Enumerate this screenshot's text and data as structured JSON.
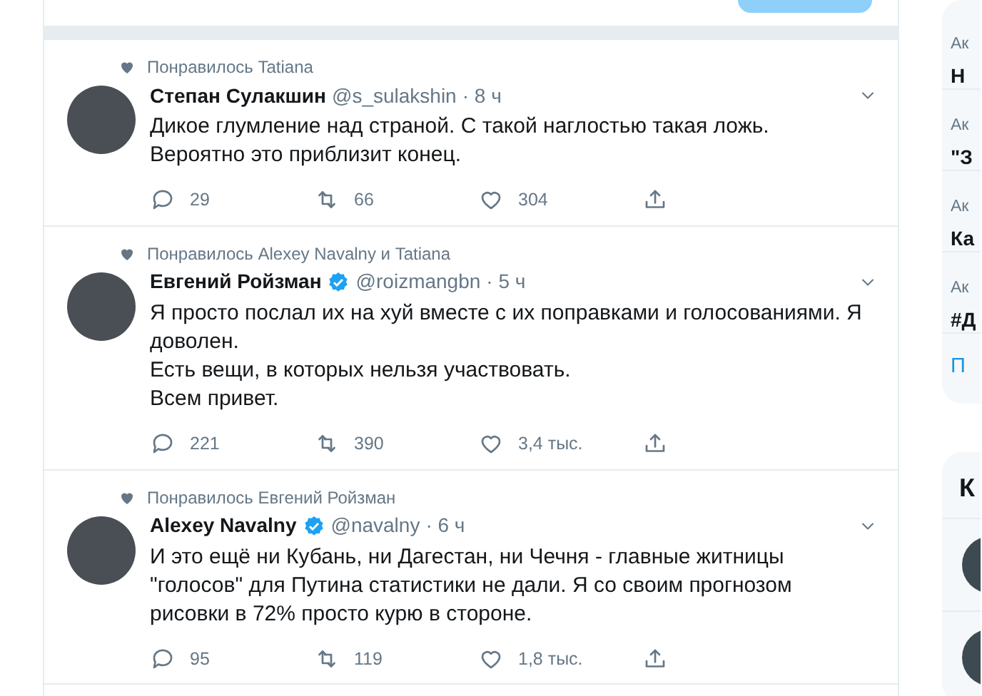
{
  "tweets": [
    {
      "liked_by": "Понравилось Tatiana",
      "name": "Степан Сулакшин",
      "verified": false,
      "handle": "@s_sulakshin",
      "time": "· 8 ч",
      "text": "Дикое глумление над страной. С такой наглостью такая ложь. Вероятно это приблизит конец.",
      "replies": "29",
      "retweets": "66",
      "likes": "304"
    },
    {
      "liked_by": "Понравилось Alexey Navalny и Tatiana",
      "name": "Евгений Ройзман",
      "verified": true,
      "handle": "@roizmangbn",
      "time": "· 5 ч",
      "text": "Я просто послал их на хуй вместе с их поправками и голосованиями. Я доволен.\nЕсть вещи, в которых нельзя участвовать.\nВсем привет.",
      "replies": "221",
      "retweets": "390",
      "likes": "3,4 тыс."
    },
    {
      "liked_by": "Понравилось Евгений Ройзман",
      "name": "Alexey Navalny",
      "verified": true,
      "handle": "@navalny",
      "time": "· 6 ч",
      "text": "И это ещё ни Кубань, ни Дагестан, ни Чечня - главные житницы \"голосов\" для Путина статистики не дали. Я со своим прогнозом рисовки в 72% просто курю в стороне.",
      "replies": "95",
      "retweets": "119",
      "likes": "1,8 тыс."
    }
  ],
  "trends": [
    {
      "context": "Ак",
      "title": "Н"
    },
    {
      "context": "Ак",
      "title": "\"З"
    },
    {
      "context": "Ак",
      "title": "Ка"
    },
    {
      "context": "Ак",
      "title": "#Д"
    }
  ],
  "trends_more": "П",
  "follow_panel": {
    "title": "К"
  }
}
